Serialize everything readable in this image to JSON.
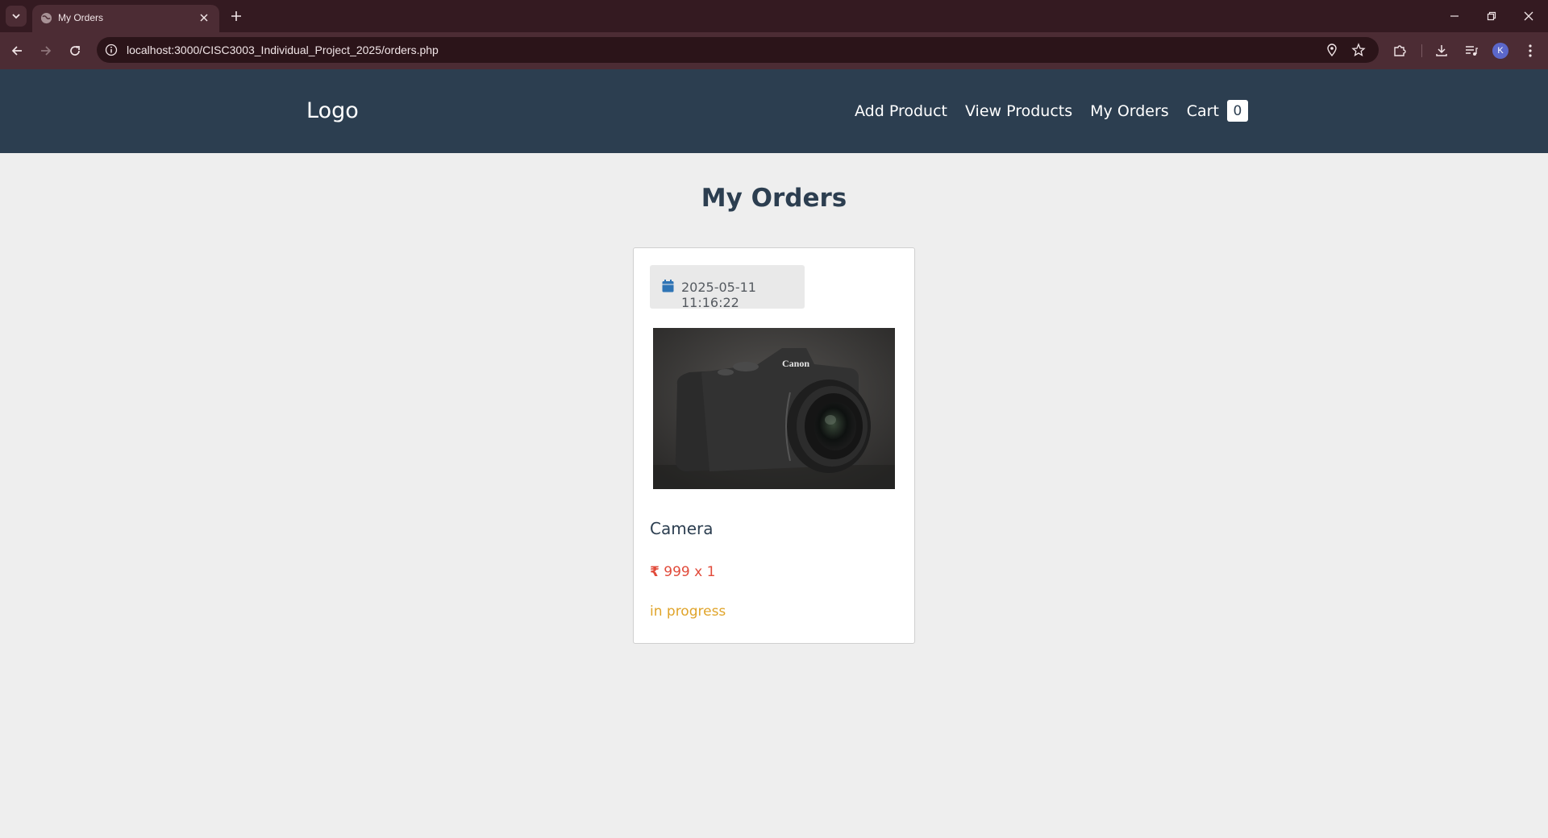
{
  "browser": {
    "tab_title": "My Orders",
    "url": "localhost:3000/CISC3003_Individual_Project_2025/orders.php",
    "profile_initial": "K"
  },
  "site": {
    "logo": "Logo",
    "nav": {
      "add_product": "Add Product",
      "view_products": "View Products",
      "my_orders": "My Orders",
      "cart": "Cart",
      "cart_count": "0"
    }
  },
  "page": {
    "title": "My Orders"
  },
  "orders": [
    {
      "date": "2025-05-11 11:16:22",
      "product_name": "Camera",
      "currency_symbol": "₹",
      "price": "999 x 1",
      "status": "in progress"
    }
  ],
  "colors": {
    "header_bg": "#2c3e50",
    "price": "#e14b3b",
    "status": "#e0a42a",
    "calendar_icon": "#2f74b5"
  }
}
